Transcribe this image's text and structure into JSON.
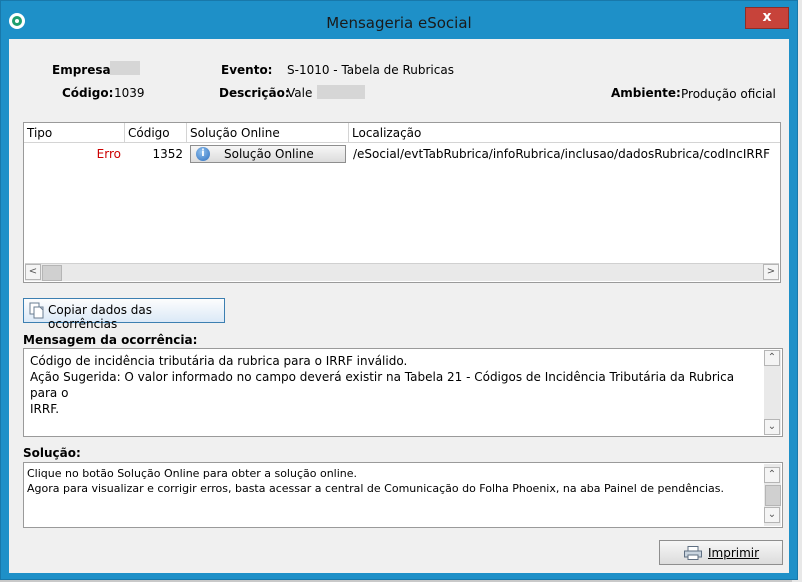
{
  "window": {
    "title": "Mensageria eSocial",
    "close_label": "x"
  },
  "header": {
    "empresa_label": "Empresa:",
    "codigo_label": "Código:",
    "codigo_value": "1039",
    "evento_label": "Evento:",
    "evento_value": "S-1010 - Tabela de Rubricas",
    "descricao_label": "Descrição:",
    "descricao_value": "Vale",
    "ambiente_label": "Ambiente:",
    "ambiente_value": "Produção oficial"
  },
  "grid": {
    "columns": [
      "Tipo",
      "Código",
      "Solução Online",
      "Localização"
    ],
    "rows": [
      {
        "tipo": "Erro",
        "codigo": "1352",
        "solucao": "Solução Online",
        "localizacao": "/eSocial/evtTabRubrica/infoRubrica/inclusao/dadosRubrica/codIncIRRF"
      }
    ],
    "error_color": "#cc0000"
  },
  "copy_button_label": "Copiar dados das ocorrências",
  "mensagem": {
    "label": "Mensagem da ocorrência:",
    "text": "Código de incidência tributária da rubrica para o IRRF inválido.\nAção Sugerida: O valor informado no campo deverá existir na Tabela 21 - Códigos de Incidência Tributária da Rubrica para o\nIRRF."
  },
  "solucao": {
    "label": "Solução:",
    "text": "Clique no botão Solução Online para obter a solução online.\nAgora para visualizar e corrigir erros, basta acessar a central de Comunicação do Folha Phoenix, na aba Painel de pendências."
  },
  "print_button_label": "Imprimir",
  "icons": {
    "app": "app-logo-icon",
    "info": "info-icon",
    "copy": "copy-icon",
    "print": "printer-icon"
  },
  "colors": {
    "titlebar": "#1e90c8",
    "close": "#c7433a"
  }
}
